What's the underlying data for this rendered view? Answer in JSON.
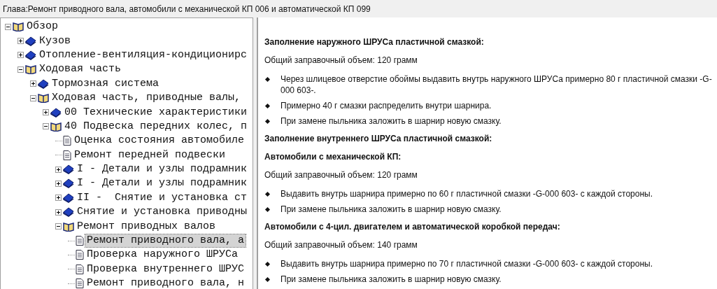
{
  "title": "Глава:Ремонт приводного вала, автомобили с механической КП 006 и автоматической КП 099",
  "tree": [
    {
      "label": "Обзор",
      "kind": "book",
      "expanded": true,
      "selected": false,
      "children": [
        {
          "label": "Кузов",
          "kind": "book",
          "expanded": false,
          "selected": false
        },
        {
          "label": "Отопление-вентиляция-кондиционирс",
          "kind": "book",
          "expanded": false,
          "selected": false
        },
        {
          "label": "Ходовая часть",
          "kind": "book",
          "expanded": true,
          "selected": false,
          "children": [
            {
              "label": "Тормозная система",
              "kind": "book",
              "expanded": false,
              "selected": false
            },
            {
              "label": "Ходовая часть, приводные валы,",
              "kind": "book",
              "expanded": true,
              "selected": false,
              "children": [
                {
                  "label": "00 Технические характеристики",
                  "kind": "book",
                  "expanded": false,
                  "selected": false
                },
                {
                  "label": "40 Подвеска передних колес, п",
                  "kind": "book",
                  "expanded": true,
                  "selected": false,
                  "children": [
                    {
                      "label": "Оценка состояния автомобиле",
                      "kind": "page",
                      "selected": false
                    },
                    {
                      "label": "Ремонт передней подвески",
                      "kind": "page",
                      "selected": false
                    },
                    {
                      "label": "I - Детали и узлы подрамник",
                      "kind": "book",
                      "expanded": false,
                      "selected": false
                    },
                    {
                      "label": "I - Детали и узлы подрамник",
                      "kind": "book",
                      "expanded": false,
                      "selected": false
                    },
                    {
                      "label": "II -  Снятие и установка ст",
                      "kind": "book",
                      "expanded": false,
                      "selected": false
                    },
                    {
                      "label": "Снятие и установка приводны",
                      "kind": "book",
                      "expanded": false,
                      "selected": false
                    },
                    {
                      "label": "Ремонт приводных валов",
                      "kind": "book",
                      "expanded": true,
                      "selected": false,
                      "children": [
                        {
                          "label": "Ремонт приводного вала, а",
                          "kind": "page",
                          "selected": true
                        },
                        {
                          "label": "Проверка наружного ШРУСа",
                          "kind": "page",
                          "selected": false
                        },
                        {
                          "label": "Проверка внутреннего ШРУС",
                          "kind": "page",
                          "selected": false
                        },
                        {
                          "label": "Ремонт приводного вала, н",
                          "kind": "page",
                          "selected": false
                        }
                      ]
                    }
                  ]
                }
              ]
            }
          ]
        }
      ]
    }
  ],
  "content": [
    {
      "kind": "heading",
      "text": "Заполнение наружного ШРУСа пластичной смазкой:"
    },
    {
      "kind": "paragraph",
      "text": "Общий заправочный объем: 120 грамм"
    },
    {
      "kind": "list",
      "items": [
        "Через шлицевое отверстие обоймы выдавить внутрь наружного ШРУСа примерно 80 г пластичной смазки -G-000 603-.",
        "Примерно 40 г смазки распределить внутри шарнира.",
        "При замене пыльника заложить в шарнир новую смазку."
      ]
    },
    {
      "kind": "heading",
      "text": "Заполнение внутреннего ШРУСа пластичной смазкой:"
    },
    {
      "kind": "heading",
      "text": "Автомобили с механической КП:"
    },
    {
      "kind": "paragraph",
      "text": "Общий заправочный объем: 120 грамм"
    },
    {
      "kind": "list",
      "items": [
        "Выдавить внутрь шарнира примерно по 60 г пластичной смазки -G-000 603- с каждой стороны.",
        "При замене пыльника заложить в шарнир новую смазку."
      ]
    },
    {
      "kind": "heading",
      "text": "Автомобили с 4-цил. двигателем и автоматической коробкой передач:"
    },
    {
      "kind": "paragraph",
      "text": "Общий заправочный объем: 140 грамм"
    },
    {
      "kind": "list",
      "items": [
        "Выдавить внутрь шарнира примерно по 70 г пластичной смазки -G-000 603- с каждой стороны.",
        "При замене пыльника заложить в шарнир новую смазку."
      ]
    }
  ]
}
